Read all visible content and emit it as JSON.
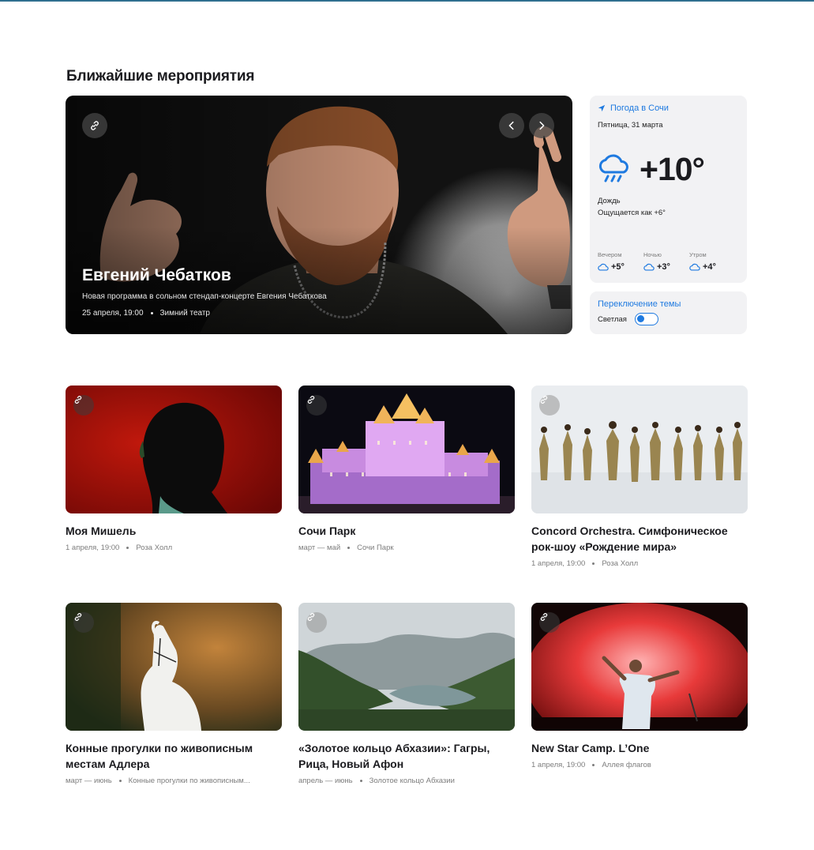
{
  "section": {
    "title": "Ближайшие мероприятия"
  },
  "hero": {
    "title": "Евгений Чебатков",
    "subtitle": "Новая программа в сольном стендап-концерте Евгения Чебаткова",
    "date": "25 апреля, 19:00",
    "place": "Зимний театр",
    "icons": {
      "link": "link-icon",
      "prev": "chevron-left-icon",
      "next": "chevron-right-icon"
    }
  },
  "weather": {
    "city": "Погода в Сочи",
    "date": "Пятница, 31 марта",
    "temperature": "+10°",
    "condition": "Дождь",
    "feels_like": "Ощущается как +6°",
    "icon": "rain-cloud-icon",
    "accent": "#1f7ae0",
    "forecast": [
      {
        "label": "Вечером",
        "value": "+5°",
        "icon": "cloud-icon"
      },
      {
        "label": "Ночью",
        "value": "+3°",
        "icon": "cloud-icon"
      },
      {
        "label": "Утром",
        "value": "+4°",
        "icon": "cloud-icon"
      }
    ]
  },
  "theme": {
    "title": "Переключение темы",
    "label": "Светлая",
    "enabled": false
  },
  "events": [
    {
      "title": "Моя Мишель",
      "date": "1 апреля, 19:00",
      "place": "Роза Холл"
    },
    {
      "title": "Сочи Парк",
      "date": "март — май",
      "place": "Сочи Парк"
    },
    {
      "title": "Concord Orchestra. Симфоническое рок-шоу «Рождение мира»",
      "date": "1 апреля, 19:00",
      "place": "Роза Холл"
    },
    {
      "title": "Конные прогулки по живописным местам Адлера",
      "date": "март — июнь",
      "place": "Конные прогулки по живописным..."
    },
    {
      "title": "«Золотое кольцо Абхазии»: Гагры, Рица, Новый Афон",
      "date": "апрель — июнь",
      "place": "Золотое кольцо Абхазии"
    },
    {
      "title": "New Star Camp. L’One",
      "date": "1 апреля, 19:00",
      "place": "Аллея флагов"
    }
  ]
}
